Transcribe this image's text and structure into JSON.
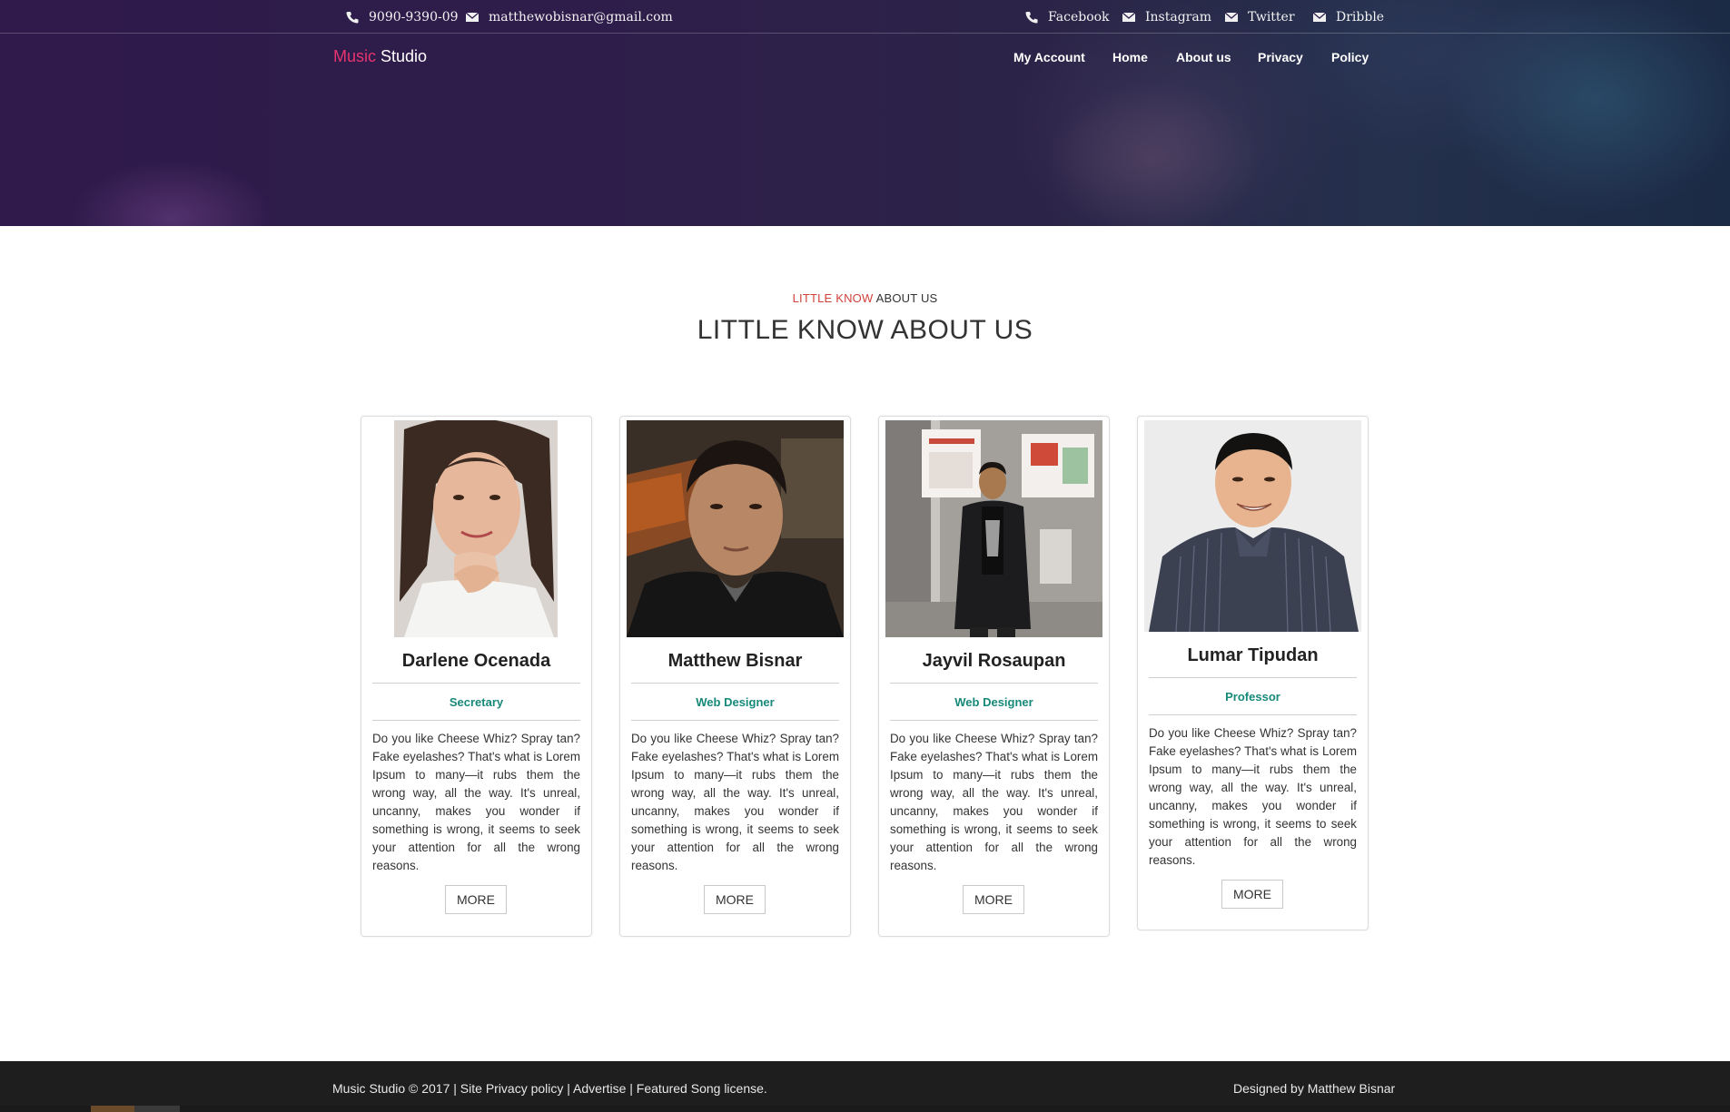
{
  "topbar": {
    "phone": "9090-9390-09",
    "email": "matthewobisnar@gmail.com",
    "social": [
      "Facebook",
      "Instagram",
      "Twitter",
      "Dribble"
    ]
  },
  "brand": {
    "part1": "Music",
    "part2": "Studio"
  },
  "nav": [
    "My Account",
    "Home",
    "About us",
    "Privacy",
    "Policy"
  ],
  "section": {
    "kicker_accent": "LITTLE KNOW",
    "kicker_rest": "ABOUT US",
    "heading": "LITTLE KNOW ABOUT US"
  },
  "team": [
    {
      "name": "Darlene Ocenada",
      "role": "Secretary",
      "description": "Do you like Cheese Whiz? Spray tan? Fake eyelashes? That's what is Lorem Ipsum to many—it rubs them the wrong way, all the way. It's unreal, uncanny, makes you wonder if something is wrong, it seems to seek your attention for all the wrong reasons.",
      "button": "MORE"
    },
    {
      "name": "Matthew Bisnar",
      "role": "Web Designer",
      "description": "Do you like Cheese Whiz? Spray tan? Fake eyelashes? That's what is Lorem Ipsum to many—it rubs them the wrong way, all the way. It's unreal, uncanny, makes you wonder if something is wrong, it seems to seek your attention for all the wrong reasons.",
      "button": "MORE"
    },
    {
      "name": "Jayvil Rosaupan",
      "role": "Web Designer",
      "description": "Do you like Cheese Whiz? Spray tan? Fake eyelashes? That's what is Lorem Ipsum to many—it rubs them the wrong way, all the way. It's unreal, uncanny, makes you wonder if something is wrong, it seems to seek your attention for all the wrong reasons.",
      "button": "MORE"
    },
    {
      "name": "Lumar Tipudan",
      "role": "Professor",
      "description": "Do you like Cheese Whiz? Spray tan? Fake eyelashes? That's what is Lorem Ipsum to many—it rubs them the wrong way, all the way. It's unreal, uncanny, makes you wonder if something is wrong, it seems to seek your attention for all the wrong reasons.",
      "button": "MORE"
    }
  ],
  "footer": {
    "left": "Music Studio © 2017 | Site Privacy policy | Advertise | Featured Song license.",
    "right": "Designed by Matthew Bisnar"
  },
  "colors": {
    "brand_accent": "#e8336f",
    "kicker_accent": "#d0433a",
    "role": "#17897a",
    "footer_bg": "#1e1e1e"
  },
  "icons": [
    "phone-icon",
    "mail-icon"
  ]
}
